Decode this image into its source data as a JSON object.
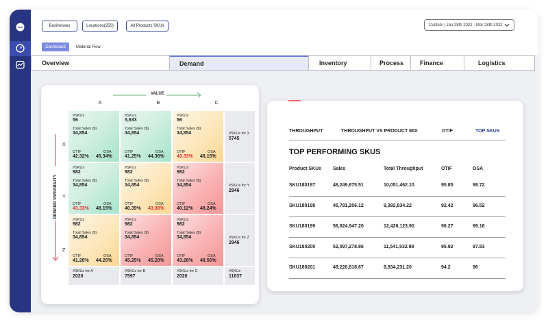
{
  "filters": {
    "businesses": "Businesses",
    "locations": "Locations(250)",
    "products": "All Products SKUs",
    "date_range": "Custom | Jan 28th 2022 - Mar 28th 2022"
  },
  "subtabs": {
    "dashboard": "Dashboard",
    "material_flow": "Material Flow"
  },
  "tabs": [
    "Overview",
    "Demand",
    "Inventory",
    "Process",
    "Finance",
    "Logistics"
  ],
  "matrix": {
    "axis_value": "VALUE",
    "axis_variability": "DEMAND VARIABILITY",
    "cols": [
      "A",
      "B",
      "C"
    ],
    "rows": [
      "X",
      "Y",
      "Z"
    ],
    "labels": {
      "skus": "#SKUs",
      "sales": "Total Sales ($)",
      "otif": "OTIF",
      "osa": "OSA"
    },
    "cells": [
      [
        {
          "skus": "56",
          "sales": "34,854",
          "otif": "42.32%",
          "osa": "45.34%",
          "otif_red": false,
          "osa_red": false,
          "color": "g"
        },
        {
          "skus": "5,633",
          "sales": "34,854",
          "otif": "41.25%",
          "osa": "44.36%",
          "otif_red": false,
          "osa_red": false,
          "color": "g"
        },
        {
          "skus": "56",
          "sales": "34,854",
          "otif": "43.33%",
          "osa": "48.15%",
          "otif_red": true,
          "osa_red": false,
          "color": "o"
        }
      ],
      [
        {
          "skus": "982",
          "sales": "34,854",
          "otif": "43.33%",
          "osa": "48.15%",
          "otif_red": true,
          "osa_red": false,
          "color": "g"
        },
        {
          "skus": "982",
          "sales": "34,854",
          "otif": "40.39%",
          "osa": "43.38%",
          "otif_red": false,
          "osa_red": true,
          "color": "o"
        },
        {
          "skus": "982",
          "sales": "34,854",
          "otif": "40.12%",
          "osa": "48.24%",
          "otif_red": false,
          "osa_red": false,
          "color": "r"
        }
      ],
      [
        {
          "skus": "982",
          "sales": "34,854",
          "otif": "41.28%",
          "osa": "44.25%",
          "otif_red": false,
          "osa_red": false,
          "color": "o"
        },
        {
          "skus": "982",
          "sales": "34,854",
          "otif": "45.25%",
          "osa": "45.28%",
          "otif_red": false,
          "osa_red": false,
          "color": "r"
        },
        {
          "skus": "982",
          "sales": "34,854",
          "otif": "43.28%",
          "osa": "48.56%",
          "otif_red": false,
          "osa_red": false,
          "color": "r"
        }
      ]
    ],
    "row_totals": [
      {
        "label": "#SKUs for X",
        "value": "5745"
      },
      {
        "label": "#SKUs for Y",
        "value": "2946"
      },
      {
        "label": "#SKUs for Z",
        "value": "2946"
      }
    ],
    "col_totals": [
      {
        "label": "#SKUs for A",
        "value": "2020"
      },
      {
        "label": "#SKUs for B",
        "value": "7597"
      },
      {
        "label": "#SKUs for C",
        "value": "2020"
      }
    ],
    "grand_total": {
      "label": "#SKUs",
      "value": "11637"
    }
  },
  "top_skus": {
    "tabs": [
      "THROUGHPUT",
      "THROUGHPUT VS PRODUCT MIX",
      "OTIF",
      "TOP SKUS"
    ],
    "title": "TOP PERFORMING SKUS",
    "headers": [
      "Product SKUs",
      "Sales",
      "Total Throughput",
      "OTIF",
      "OSA"
    ],
    "rows": [
      [
        "SKU180197",
        "48,249,675.51",
        "10,051,462.10",
        "95.85",
        "98.72"
      ],
      [
        "SKU180198",
        "45,781,206.12",
        "9,392,834.22",
        "92.42",
        "96.52"
      ],
      [
        "SKU180199",
        "56,824,947.20",
        "12,426,123.90",
        "96.27",
        "99.16"
      ],
      [
        "SKU180200",
        "52,097,278.86",
        "11,541,532.98",
        "95.92",
        "97.83"
      ],
      [
        "SKU180201",
        "49,220,818.67",
        "9,934,231.20",
        "94.2",
        "96"
      ]
    ]
  }
}
